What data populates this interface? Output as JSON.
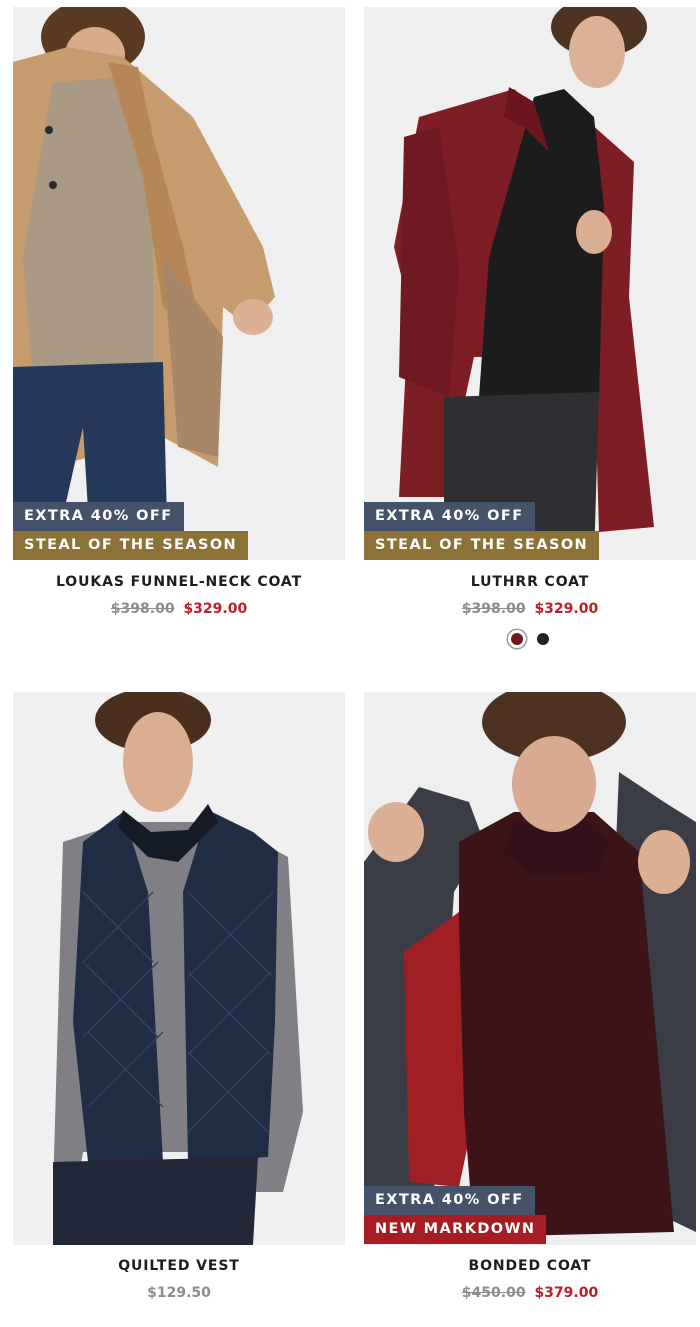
{
  "products": [
    {
      "name": "LOUKAS FUNNEL-NECK COAT",
      "original_price": "$398.00",
      "sale_price": "$329.00",
      "badges": [
        "EXTRA 40% OFF",
        "STEAL OF THE SEASON"
      ],
      "image_alt": "camel-coat-model-photo"
    },
    {
      "name": "LUTHRR COAT",
      "original_price": "$398.00",
      "sale_price": "$329.00",
      "badges": [
        "EXTRA 40% OFF",
        "STEAL OF THE SEASON"
      ],
      "swatches": [
        {
          "color": "#6b1a1e",
          "selected": true
        },
        {
          "color": "#222222",
          "selected": false
        }
      ],
      "image_alt": "burgundy-coat-model-photo"
    },
    {
      "name": "QUILTED VEST",
      "price": "$129.50",
      "image_alt": "navy-quilted-vest-model-photo"
    },
    {
      "name": "BONDED COAT",
      "original_price": "$450.00",
      "sale_price": "$379.00",
      "badges": [
        "EXTRA 40% OFF",
        "NEW MARKDOWN"
      ],
      "image_alt": "charcoal-coat-model-photo"
    }
  ],
  "colors": {
    "badge_extra": "#44526a",
    "badge_steal": "#8c7236",
    "badge_new": "#a61c22",
    "sale_price": "#c11d25",
    "original_price": "#8d8d8d"
  }
}
